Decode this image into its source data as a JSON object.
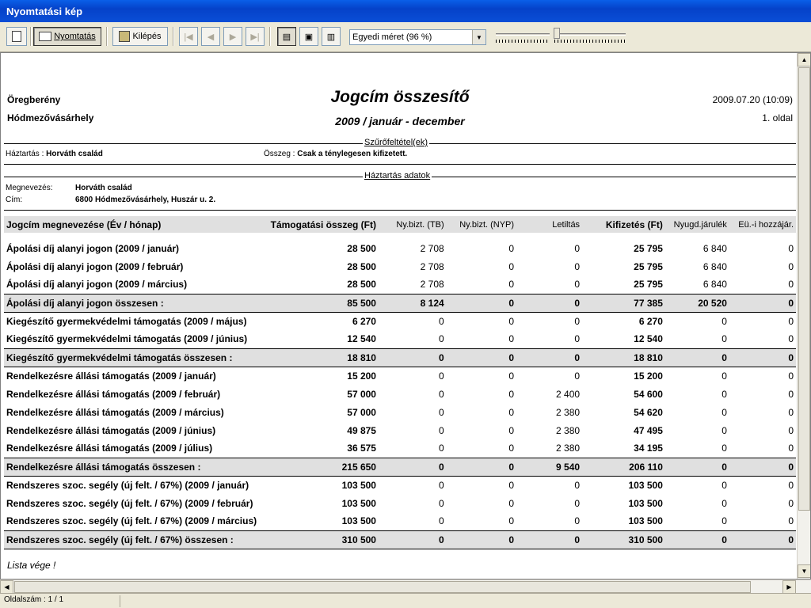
{
  "window": {
    "title": "Nyomtatási kép"
  },
  "toolbar": {
    "print_label": "Nyomtatás",
    "exit_label": "Kilépés",
    "zoom_value": "Egyedi méret (96 %)"
  },
  "report": {
    "org_line1": "Öregberény",
    "org_line2": "Hódmezővásárhely",
    "title": "Jogcím összesítő",
    "subtitle": "2009 / január - december",
    "datetime": "2009.07.20 (10:09)",
    "page": "1. oldal",
    "filters_header": "Szűrőfeltétel(ek)",
    "filter_household_label": "Háztartás :",
    "filter_household_value": "Horváth család",
    "filter_amount_label": "Összeg :",
    "filter_amount_value": "Csak a ténylegesen kifizetett.",
    "household_header": "Háztartás adatok",
    "name_label": "Megnevezés:",
    "name_value": "Horváth család",
    "address_label": "Cím:",
    "address_value": "6800 Hódmezővásárhely, Huszár u. 2.",
    "columns": [
      "Jogcím megnevezése (Év / hónap)",
      "Támogatási összeg (Ft)",
      "Ny.bizt. (TB)",
      "Ny.bizt. (NYP)",
      "Letiltás",
      "Kifizetés (Ft)",
      "Nyugd.járulék",
      "Eü.-i hozzájár."
    ],
    "rows": [
      {
        "type": "row",
        "cells": [
          "Ápolási díj alanyi jogon (2009 / január)",
          "28 500",
          "2 708",
          "0",
          "0",
          "25 795",
          "6 840",
          "0"
        ]
      },
      {
        "type": "row",
        "cells": [
          "Ápolási díj alanyi jogon (2009 / február)",
          "28 500",
          "2 708",
          "0",
          "0",
          "25 795",
          "6 840",
          "0"
        ]
      },
      {
        "type": "row",
        "cells": [
          "Ápolási díj alanyi jogon (2009 / március)",
          "28 500",
          "2 708",
          "0",
          "0",
          "25 795",
          "6 840",
          "0"
        ]
      },
      {
        "type": "sum",
        "cells": [
          "Ápolási díj alanyi jogon összesen :",
          "85 500",
          "8 124",
          "0",
          "0",
          "77 385",
          "20 520",
          "0"
        ]
      },
      {
        "type": "row",
        "cells": [
          "Kiegészítő gyermekvédelmi támogatás (2009 / május)",
          "6 270",
          "0",
          "0",
          "0",
          "6 270",
          "0",
          "0"
        ]
      },
      {
        "type": "row",
        "cells": [
          "Kiegészítő gyermekvédelmi támogatás (2009 / június)",
          "12 540",
          "0",
          "0",
          "0",
          "12 540",
          "0",
          "0"
        ]
      },
      {
        "type": "sum",
        "cells": [
          "Kiegészítő gyermekvédelmi támogatás összesen :",
          "18 810",
          "0",
          "0",
          "0",
          "18 810",
          "0",
          "0"
        ]
      },
      {
        "type": "row",
        "cells": [
          "Rendelkezésre állási támogatás (2009 / január)",
          "15 200",
          "0",
          "0",
          "0",
          "15 200",
          "0",
          "0"
        ]
      },
      {
        "type": "row",
        "cells": [
          "Rendelkezésre állási támogatás (2009 / február)",
          "57 000",
          "0",
          "0",
          "2 400",
          "54 600",
          "0",
          "0"
        ]
      },
      {
        "type": "row",
        "cells": [
          "Rendelkezésre állási támogatás (2009 / március)",
          "57 000",
          "0",
          "0",
          "2 380",
          "54 620",
          "0",
          "0"
        ]
      },
      {
        "type": "row",
        "cells": [
          "Rendelkezésre állási támogatás (2009 / június)",
          "49 875",
          "0",
          "0",
          "2 380",
          "47 495",
          "0",
          "0"
        ]
      },
      {
        "type": "row",
        "cells": [
          "Rendelkezésre állási támogatás (2009 / július)",
          "36 575",
          "0",
          "0",
          "2 380",
          "34 195",
          "0",
          "0"
        ]
      },
      {
        "type": "sum",
        "cells": [
          "Rendelkezésre állási támogatás összesen :",
          "215 650",
          "0",
          "0",
          "9 540",
          "206 110",
          "0",
          "0"
        ]
      },
      {
        "type": "row",
        "cells": [
          "Rendszeres szoc. segély (új felt. / 67%) (2009 / január)",
          "103 500",
          "0",
          "0",
          "0",
          "103 500",
          "0",
          "0"
        ]
      },
      {
        "type": "row",
        "cells": [
          "Rendszeres szoc. segély (új felt. / 67%) (2009 / február)",
          "103 500",
          "0",
          "0",
          "0",
          "103 500",
          "0",
          "0"
        ]
      },
      {
        "type": "row",
        "cells": [
          "Rendszeres szoc. segély (új felt. / 67%) (2009 / március)",
          "103 500",
          "0",
          "0",
          "0",
          "103 500",
          "0",
          "0"
        ]
      },
      {
        "type": "sum",
        "cells": [
          "Rendszeres szoc. segély (új felt. / 67%) összesen :",
          "310 500",
          "0",
          "0",
          "0",
          "310 500",
          "0",
          "0"
        ]
      }
    ],
    "list_end": "Lista vége !"
  },
  "status": {
    "page_count": "Oldalszám : 1 / 1"
  }
}
